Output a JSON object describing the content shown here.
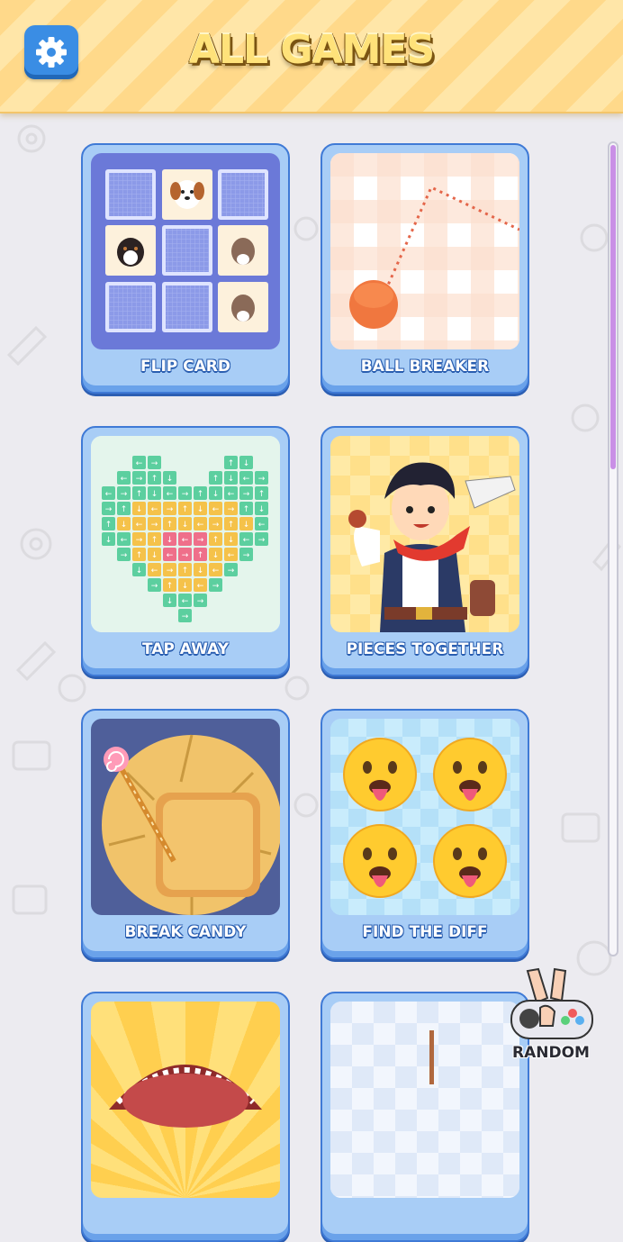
{
  "header": {
    "title": "ALL GAMES",
    "settings_icon": "gear-icon",
    "accent": "#ffd98a"
  },
  "games": [
    {
      "label": "FLIP CARD",
      "icon": "flip-card-thumbnail"
    },
    {
      "label": "BALL BREAKER",
      "icon": "ball-breaker-thumbnail"
    },
    {
      "label": "TAP AWAY",
      "icon": "tap-away-thumbnail"
    },
    {
      "label": "PIECES TOGETHER",
      "icon": "pieces-together-thumbnail"
    },
    {
      "label": "BREAK CANDY",
      "icon": "break-candy-thumbnail"
    },
    {
      "label": "FIND THE DIFF",
      "icon": "find-the-diff-thumbnail"
    }
  ],
  "random": {
    "label": "RANDOM",
    "icon": "random-gamepad-icon"
  },
  "colors": {
    "card": "#a8cdf6",
    "card_border": "#3f7ad6",
    "scroll_thumb": "#c98fe6"
  }
}
